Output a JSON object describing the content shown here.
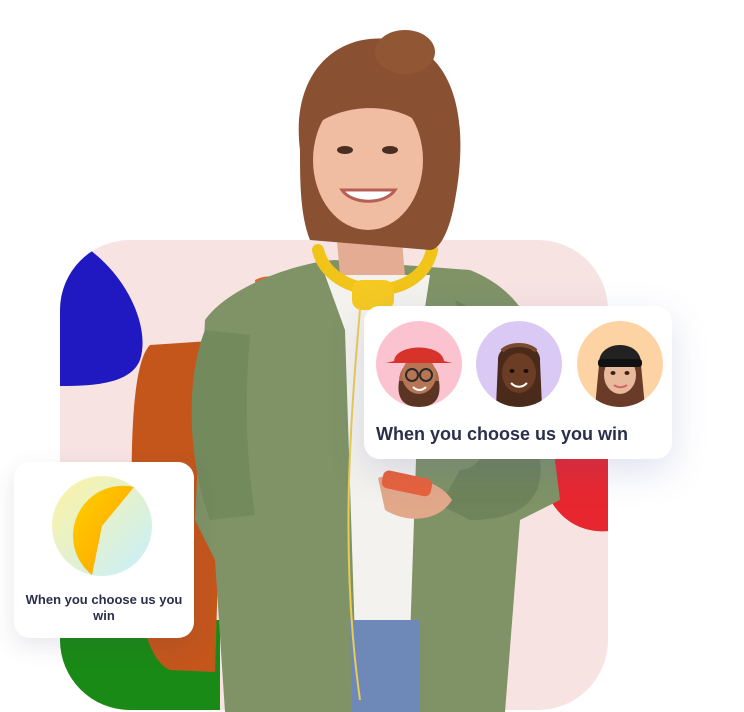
{
  "avatar_card": {
    "caption": "When you choose us you win",
    "avatars": [
      {
        "icon": "avatar-red-bucket-hat-icon",
        "bg": "#fbc3cf"
      },
      {
        "icon": "avatar-braids-icon",
        "bg": "#d9c9f4"
      },
      {
        "icon": "avatar-beanie-icon",
        "bg": "#fed3a4"
      }
    ]
  },
  "pie_card": {
    "caption": "When you choose us you win",
    "colors": [
      "#ffc000",
      "#d6f6ff"
    ]
  },
  "colors": {
    "card_bg": "#f8e3e3",
    "blue_blob": "#2018c0",
    "red_blob": "#e8262f",
    "green_blob": "#1a8a16",
    "text": "#2b2f4a"
  }
}
